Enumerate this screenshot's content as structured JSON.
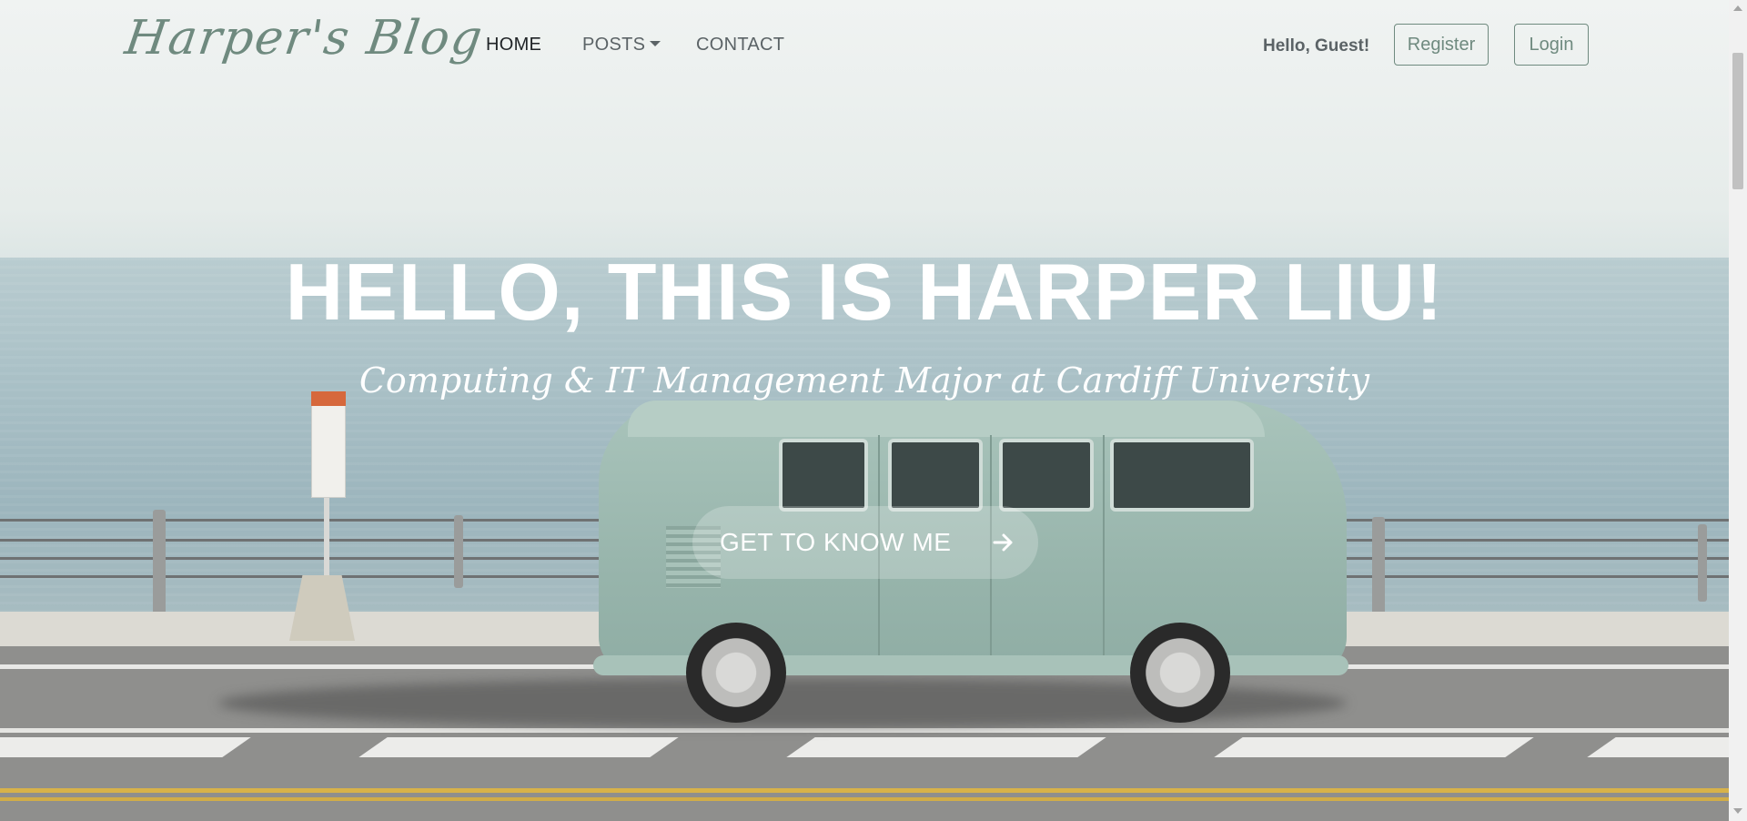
{
  "navbar": {
    "brand": "Harper's Blog",
    "links": [
      {
        "label": "HOME",
        "active": true
      },
      {
        "label": "POSTS",
        "dropdown": true
      },
      {
        "label": "CONTACT"
      }
    ],
    "greeting": "Hello, Guest!",
    "register_label": "Register",
    "login_label": "Login"
  },
  "hero": {
    "title": "HELLO, THIS IS HARPER LIU!",
    "subtitle": "Computing & IT Management Major at Cardiff University",
    "cta_label": "GET TO KNOW ME",
    "cta_icon": "arrow-right-icon"
  },
  "colors": {
    "accent": "#6f8a7f",
    "nav_text": "#5b6366",
    "nav_active": "#1f2326",
    "hero_text": "#ffffff"
  }
}
